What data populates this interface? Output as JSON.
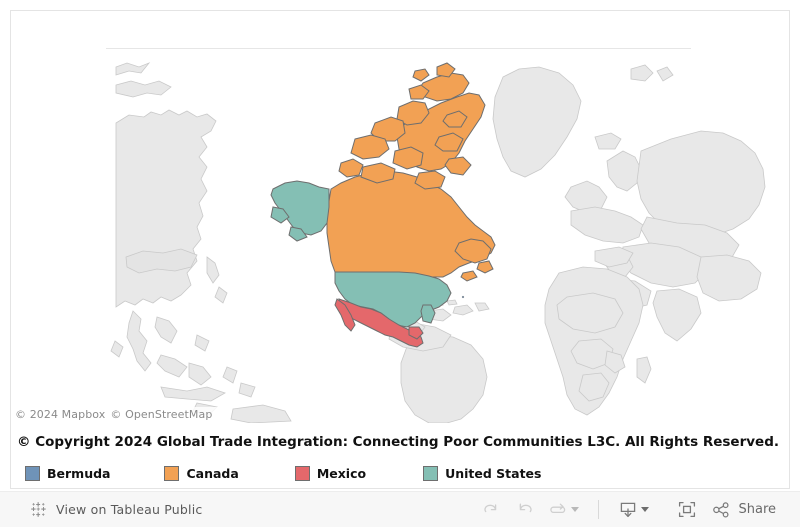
{
  "viz": {
    "map": {
      "attribution": {
        "mapbox": "© 2024 Mapbox",
        "openstreetmap": "© OpenStreetMap"
      },
      "base_land_color": "#e8e8e8",
      "base_border_color": "#c9c9c9",
      "ocean_color": "#ffffff",
      "highlight_border_color": "#6e6e6e"
    },
    "caption": "© Copyright 2024 Global Trade Integration: Connecting Poor Communities L3C. All Rights Reserved.",
    "legend": {
      "items": [
        {
          "label": "Bermuda",
          "color": "#6f93b8"
        },
        {
          "label": "Canada",
          "color": "#f2a154"
        },
        {
          "label": "Mexico",
          "color": "#e4686b"
        },
        {
          "label": "United States",
          "color": "#84bfb4"
        }
      ]
    }
  },
  "toolbar": {
    "tableau_public": {
      "label": "View on Tableau Public",
      "icon": "tableau-logo-icon"
    },
    "buttons": [
      {
        "name": "undo-button",
        "icon": "undo-icon",
        "label": ""
      },
      {
        "name": "redo-button",
        "icon": "redo-icon",
        "label": ""
      },
      {
        "name": "reset-button",
        "icon": "reset-icon",
        "label": ""
      }
    ],
    "download": {
      "name": "download-button",
      "icon": "download-icon"
    },
    "fullscreen": {
      "name": "fullscreen-button",
      "icon": "fullscreen-icon"
    },
    "share": {
      "name": "share-button",
      "icon": "share-icon",
      "label": "Share"
    }
  }
}
